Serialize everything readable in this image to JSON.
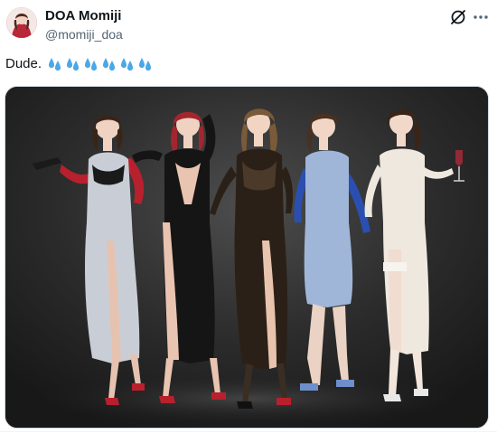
{
  "author": {
    "display_name": "DOA Momiji",
    "handle": "@momiji_doa",
    "avatar_icon": "avatar-image"
  },
  "header_actions": {
    "grok_icon": "grok-slash-icon",
    "more_icon": "more-dots-icon"
  },
  "post": {
    "text": "Dude.",
    "emoji": [
      "sweat-droplets",
      "sweat-droplets",
      "sweat-droplets",
      "sweat-droplets",
      "sweat-droplets",
      "sweat-droplets"
    ],
    "emoji_color": "#4aa8e8"
  },
  "media": {
    "type": "image",
    "background_color": "#2a2a2a",
    "figures": [
      {
        "dress_color": "#c9ced6",
        "accent_color": "#b8202e",
        "hair_color": "#3a2418"
      },
      {
        "dress_color": "#151515",
        "accent_color": "#151515",
        "hair_color": "#a2262e"
      },
      {
        "dress_color": "#2b2017",
        "accent_color": "#2b2017",
        "hair_color": "#7a5a38"
      },
      {
        "dress_color": "#9fb6d8",
        "accent_color": "#2b4fb0",
        "hair_color": "#4a3020"
      },
      {
        "dress_color": "#efe8de",
        "accent_color": "#efe8de",
        "hair_color": "#3a2418"
      }
    ]
  }
}
